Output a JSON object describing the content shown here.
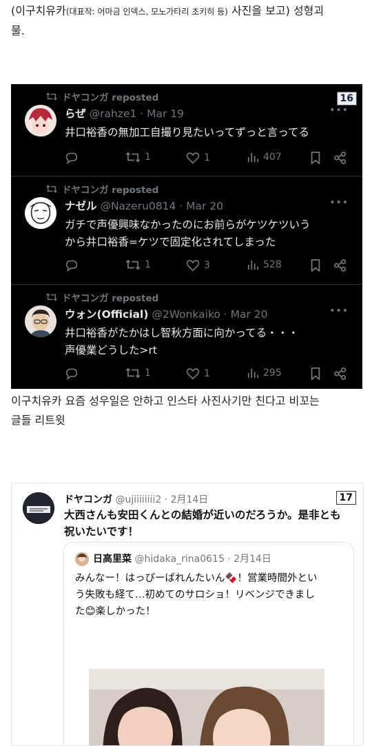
{
  "intro": {
    "line_part1": "(이구치유카",
    "line_part_small": "(대표작: 어마금 인덱스, 모노가타리 초키히 등)",
    "line_part2": " 사진을 보고) 성형괴",
    "line_part3": "물."
  },
  "dark_tweets": {
    "badge": "16",
    "items": [
      {
        "repost_label": "ドヤコンガ reposted",
        "name": "らぜ",
        "handle": "@rahze1 · Mar 19",
        "lines": [
          "井口裕香の無加工自撮り見たいってずっと言ってる"
        ],
        "replies": "",
        "retweets": "1",
        "likes": "1",
        "views": "407"
      },
      {
        "repost_label": "ドヤコンガ reposted",
        "name": "ナゼル",
        "handle": "@Nazeru0814 · Mar 20",
        "lines": [
          "ガチで声優興味なかったのにお前らがケツケツいう",
          "から井口裕香=ケツで固定化されてしまった"
        ],
        "replies": "",
        "retweets": "1",
        "likes": "3",
        "views": "528"
      },
      {
        "repost_label": "ドヤコンガ reposted",
        "name": "ウォン(Official)",
        "handle": "@2Wonkaiko · Mar 20",
        "lines": [
          "井口裕香がたかはし智秋方面に向かってる・・・",
          "声優業どうした>rt"
        ],
        "replies": "",
        "retweets": "1",
        "likes": "1",
        "views": "295"
      }
    ]
  },
  "caption": {
    "line1": "이구치유카 요즘 성우일은 안하고 인스타 사진사기만 친다고 비꼬는",
    "line2": "글들 리트윗"
  },
  "light_tweet": {
    "badge": "17",
    "name": "ドヤコンガ",
    "handle": "@ujiiiiiiii2 · 2月14日",
    "line1": "大西さんも安田くんとの結婚が近いのだろうか。是非とも",
    "line2": "祝いたいです！",
    "quote": {
      "name": "日高里菜",
      "handle": "@hidaka_rina0615 · 2月14日",
      "line1": "みんなー！はっぴーばれんたいん🍫！営業時間外とい",
      "line2": "う失敗も経て…初めてのサロショ！リベンジできまし",
      "line3": "た😊楽しかった！"
    }
  },
  "icons": [
    "reply-icon",
    "retweet-icon",
    "like-icon",
    "views-icon",
    "bookmark-icon",
    "share-icon",
    "more-icon",
    "repost-icon"
  ],
  "colors": {
    "dark_bg": "#000000",
    "dark_text": "#e7e9ea",
    "muted": "#71767b",
    "badge_bg": "#e8eef7"
  }
}
